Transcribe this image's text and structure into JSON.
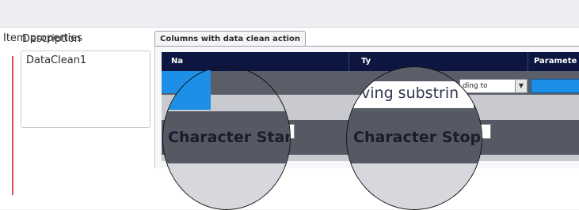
{
  "panel": {
    "title": "Item properties"
  },
  "description": {
    "label": "Description",
    "value": "DataClean1"
  },
  "tab": {
    "label": "Columns with data clean action"
  },
  "grid": {
    "headers": [
      "Na",
      "Ty",
      "Paramete"
    ],
    "type_combo_value": "ding to",
    "type_zoom_text": "ving substrin"
  },
  "annotations": {
    "left": "Character Start",
    "right": "Character Stop"
  },
  "colors": {
    "accent_blue": "#1e8fe6",
    "header_navy": "#0c1640",
    "required_red": "#d9534f"
  }
}
